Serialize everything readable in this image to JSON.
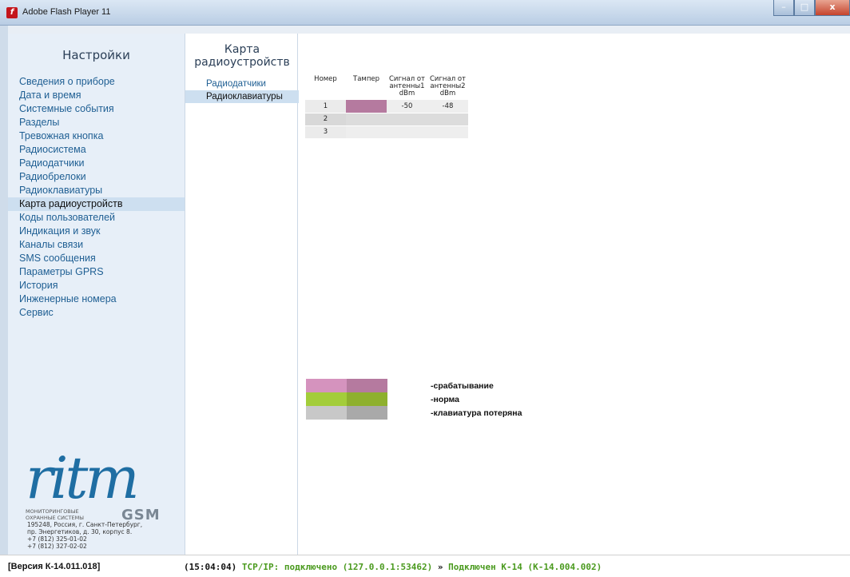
{
  "window": {
    "title": "Adobe Flash Player 11"
  },
  "sidebar": {
    "heading": "Настройки",
    "items": [
      "Сведения о приборе",
      "Дата и время",
      "Системные события",
      "Разделы",
      "Тревожная кнопка",
      "Радиосистема",
      "Радиодатчики",
      "Радиобрелоки",
      "Радиоклавиатуры",
      "Карта радиоустройств",
      "Коды пользователей",
      "Индикация и звук",
      "Каналы связи",
      "SMS сообщения",
      "Параметры GPRS",
      "История",
      "Инженерные номера",
      "Сервис"
    ],
    "active_index": 9
  },
  "logo": {
    "word": "ritm",
    "subtitle_line1": "МОНИТОРИНГОВЫЕ",
    "subtitle_line2": "ОХРАННЫЕ СИСТЕМЫ",
    "gsm": "GSM"
  },
  "address": "195248, Россия, г. Санкт-Петербург,\nпр. Энергетиков, д. 30, корпус 8.\n+7 (812) 325-01-02\n+7 (812) 327-02-02",
  "subpanel": {
    "heading": "Карта радиоустройств",
    "items": [
      "Радиодатчики",
      "Радиоклавиатуры"
    ],
    "active_index": 1
  },
  "table": {
    "headers": [
      "Номер",
      "Тампер",
      "Сигнал от антенны1 dBm",
      "Сигнал от антенны2 dBm"
    ],
    "rows": [
      {
        "num": "1",
        "tamper": "срабатывание",
        "ant1": "-50",
        "ant2": "-48"
      },
      {
        "num": "2",
        "tamper": "",
        "ant1": "",
        "ant2": ""
      },
      {
        "num": "3",
        "tamper": "",
        "ant1": "",
        "ant2": ""
      }
    ]
  },
  "legend": [
    {
      "label": "-срабатывание",
      "colors": [
        "#d593be",
        "#b57a9f"
      ]
    },
    {
      "label": "-норма",
      "colors": [
        "#a3cd3a",
        "#8eb02e"
      ]
    },
    {
      "label": "-клавиатура потеряна",
      "colors": [
        "#c8c8c8",
        "#a9a9a9"
      ]
    }
  ],
  "statusbar": {
    "version": "[Версия К-14.011.018]",
    "time": "(15:04:04)",
    "tcp": "TCP/IP: подключено (127.0.0.1:53462)",
    "sep": "»",
    "conn": "Подключен К-14 (К-14.004.002)"
  }
}
